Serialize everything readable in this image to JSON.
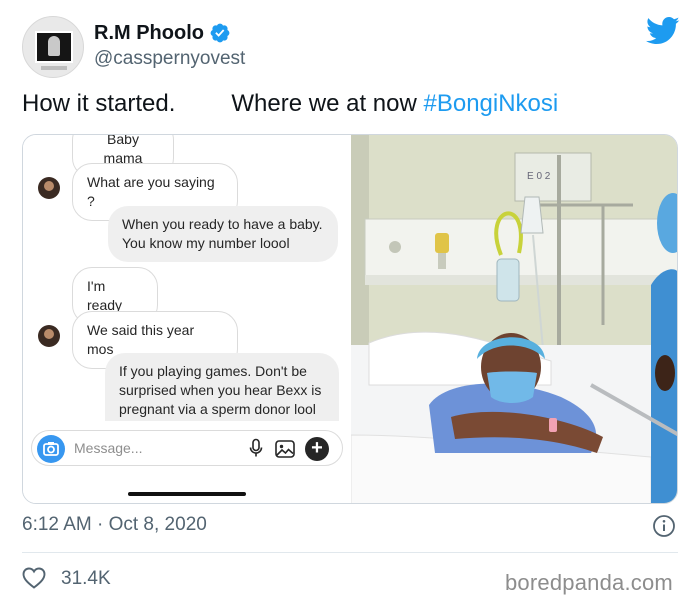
{
  "author": {
    "name": "R.M Phoolo",
    "handle": "@casspernyovest",
    "verified": true
  },
  "tweet": {
    "text_part1": "How it started.",
    "text_part2": "Where we at now",
    "hashtag": "#BongiNkosi",
    "timestamp": "6:12 AM · Oct 8, 2020",
    "like_count": "31.4K"
  },
  "chat": {
    "messages": [
      {
        "text": "Baby mama",
        "direction": "incoming"
      },
      {
        "text": "What are you saying ?",
        "direction": "incoming"
      },
      {
        "text": "When you ready to have a baby. You know my number loool",
        "direction": "outgoing"
      },
      {
        "text": "I'm ready",
        "direction": "incoming"
      },
      {
        "text": "We said this year mos",
        "direction": "incoming"
      },
      {
        "text": "If you playing games. Don't be surprised when you hear Bexx is pregnant via a sperm donor  lool",
        "direction": "outgoing"
      }
    ],
    "composer_placeholder": "Message..."
  },
  "photo": {
    "wall_sign": "E 0 2"
  },
  "watermark": "boredpanda.com",
  "colors": {
    "brand_blue": "#1d9bf0",
    "twitter_bird": "#1d9bf0",
    "secondary_text": "#536471",
    "instagram_camera": "#3797f0"
  },
  "icons": [
    "verified-badge-icon",
    "twitter-bird-icon",
    "camera-icon",
    "microphone-icon",
    "gallery-icon",
    "plus-icon",
    "info-icon",
    "heart-icon"
  ]
}
